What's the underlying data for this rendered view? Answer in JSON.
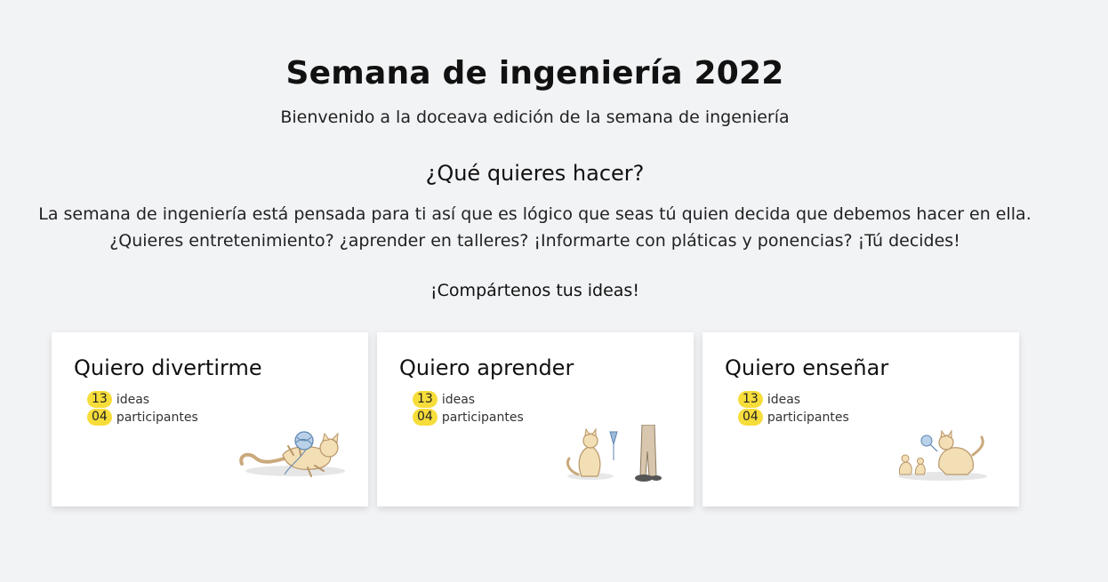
{
  "header": {
    "title": "Semana de ingeniería 2022",
    "subtitle": "Bienvenido a la doceava edición de la semana de ingeniería"
  },
  "intro": {
    "question": "¿Qué quieres hacer?",
    "line1": "La semana de ingeniería está pensada para ti así que es lógico que seas tú quien decida que debemos hacer en ella.",
    "line2": "¿Quieres entretenimiento? ¿aprender en talleres? ¡Informarte con pláticas y ponencias? ¡Tú decides!",
    "share": "¡Compártenos tus ideas!"
  },
  "cards": [
    {
      "title": "Quiero divertirme",
      "ideas_count": "13",
      "ideas_label": "ideas",
      "participants_count": "04",
      "participants_label": "participantes",
      "illustration": "cat-playing-yarn-illustration"
    },
    {
      "title": "Quiero aprender",
      "ideas_count": "13",
      "ideas_label": "ideas",
      "participants_count": "04",
      "participants_label": "participantes",
      "illustration": "cat-learning-illustration"
    },
    {
      "title": "Quiero enseñar",
      "ideas_count": "13",
      "ideas_label": "ideas",
      "participants_count": "04",
      "participants_label": "participantes",
      "illustration": "cat-teaching-kittens-illustration"
    }
  ],
  "colors": {
    "background": "#f2f3f5",
    "card": "#ffffff",
    "badge": "#f7dd3a"
  }
}
